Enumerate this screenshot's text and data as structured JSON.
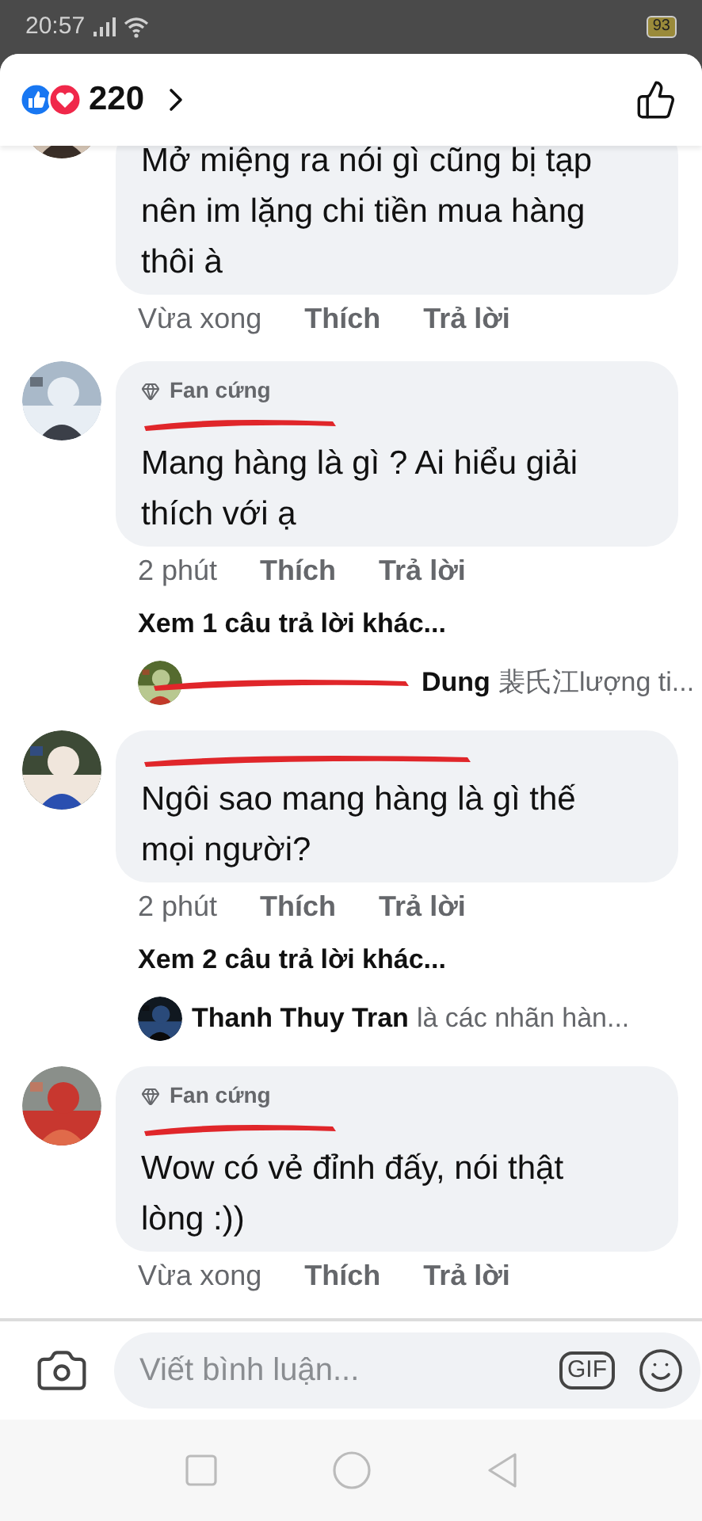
{
  "status_bar": {
    "time": "20:57",
    "battery": "93"
  },
  "header": {
    "reaction_count": "220"
  },
  "comments": [
    {
      "text": "Mở miệng ra nói gì cũng bị tạp nên im lặng chi tiền mua hàng thôi à",
      "time": "Vừa xong",
      "like": "Thích",
      "reply": "Trả lời"
    },
    {
      "badge": "Fan cứng",
      "name_redacted": true,
      "text": "Mang hàng là gì ? Ai hiểu giải thích với ạ",
      "time": "2 phút",
      "like": "Thích",
      "reply": "Trả lời",
      "more_replies": "Xem 1 câu trả lời khác...",
      "reply_preview": {
        "name_redacted": true,
        "name": "Dung",
        "text": "裴氏江lượng ti..."
      }
    },
    {
      "name_redacted": true,
      "text": "Ngôi sao mang hàng là gì thế mọi người?",
      "time": "2 phút",
      "like": "Thích",
      "reply": "Trả lời",
      "more_replies": "Xem 2 câu trả lời khác...",
      "reply_preview": {
        "name_redacted": false,
        "name": "Thanh Thuy Tran",
        "text": "là các nhãn hàn..."
      }
    },
    {
      "badge": "Fan cứng",
      "name_redacted": true,
      "text": "Wow có vẻ đỉnh đấy, nói thật lòng :))",
      "time": "Vừa xong",
      "like": "Thích",
      "reply": "Trả lời"
    }
  ],
  "composer": {
    "placeholder": "Viết bình luận...",
    "gif_label": "GIF"
  }
}
